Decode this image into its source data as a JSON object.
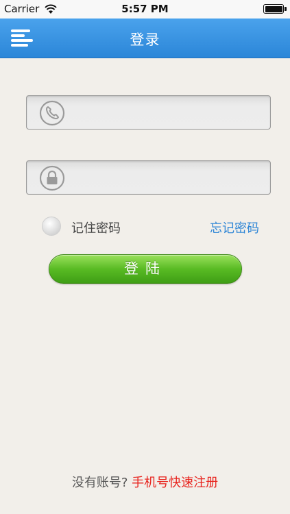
{
  "status_bar": {
    "carrier": "Carrier",
    "time": "5:57 PM"
  },
  "nav": {
    "title": "登录",
    "menu_icon": "menu-icon"
  },
  "form": {
    "phone": {
      "value": "",
      "placeholder": "",
      "icon": "phone-icon"
    },
    "password": {
      "value": "",
      "placeholder": "",
      "icon": "lock-icon"
    },
    "remember_label": "记住密码",
    "remember_checked": false,
    "forgot_label": "忘记密码",
    "login_label": "登陆"
  },
  "footer": {
    "prompt": "没有账号? ",
    "register_label": "手机号快速注册"
  },
  "colors": {
    "nav_blue": "#3a96e3",
    "link_blue": "#2e86d6",
    "login_green": "#59bb24",
    "register_red": "#e8231d",
    "background": "#f2efea"
  }
}
